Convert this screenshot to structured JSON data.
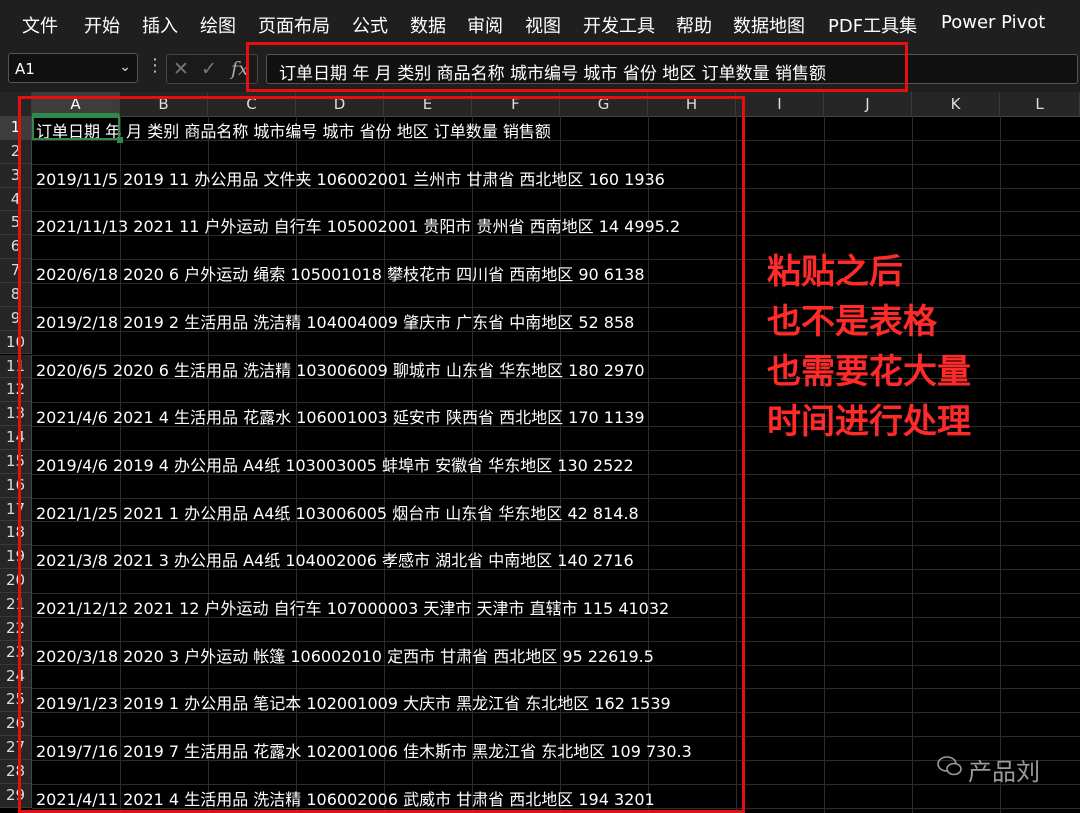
{
  "menu": [
    "文件",
    "开始",
    "插入",
    "绘图",
    "页面布局",
    "公式",
    "数据",
    "审阅",
    "视图",
    "开发工具",
    "帮助",
    "数据地图",
    "PDF工具集",
    "Power Pivot"
  ],
  "name_box": "A1",
  "formula_bar": {
    "fx": "fx",
    "cancel": "✕",
    "enter": "✓",
    "content": "订单日期 年 月 类别 商品名称 城市编号 城市 省份 地区 订单数量 销售额"
  },
  "columns": [
    "A",
    "B",
    "C",
    "D",
    "E",
    "F",
    "G",
    "H",
    "I",
    "J",
    "K",
    "L"
  ],
  "rows": [
    {
      "num": "1",
      "text": "订单日期 年 月 类别 商品名称 城市编号 城市 省份 地区 订单数量 销售额"
    },
    {
      "num": "2",
      "text": ""
    },
    {
      "num": "3",
      "text": "2019/11/5 2019 11 办公用品 文件夹 106002001 兰州市 甘肃省 西北地区 160 1936"
    },
    {
      "num": "4",
      "text": ""
    },
    {
      "num": "5",
      "text": "2021/11/13 2021 11 户外运动 自行车 105002001 贵阳市 贵州省 西南地区 14 4995.2"
    },
    {
      "num": "6",
      "text": ""
    },
    {
      "num": "7",
      "text": "2020/6/18 2020 6 户外运动 绳索 105001018 攀枝花市 四川省 西南地区 90 6138"
    },
    {
      "num": "8",
      "text": ""
    },
    {
      "num": "9",
      "text": "2019/2/18 2019 2 生活用品 洗洁精 104004009 肇庆市 广东省 中南地区 52 858"
    },
    {
      "num": "10",
      "text": ""
    },
    {
      "num": "11",
      "text": "2020/6/5 2020 6 生活用品 洗洁精 103006009 聊城市 山东省 华东地区 180 2970"
    },
    {
      "num": "12",
      "text": ""
    },
    {
      "num": "13",
      "text": "2021/4/6 2021 4 生活用品 花露水 106001003 延安市 陕西省 西北地区 170 1139"
    },
    {
      "num": "14",
      "text": ""
    },
    {
      "num": "15",
      "text": "2019/4/6 2019 4 办公用品 A4纸 103003005 蚌埠市 安徽省 华东地区 130 2522"
    },
    {
      "num": "16",
      "text": ""
    },
    {
      "num": "17",
      "text": "2021/1/25 2021 1 办公用品 A4纸 103006005 烟台市 山东省 华东地区 42 814.8"
    },
    {
      "num": "18",
      "text": ""
    },
    {
      "num": "19",
      "text": "2021/3/8 2021 3 办公用品 A4纸 104002006 孝感市 湖北省 中南地区 140 2716"
    },
    {
      "num": "20",
      "text": ""
    },
    {
      "num": "21",
      "text": "2021/12/12 2021 12 户外运动 自行车 107000003 天津市 天津市 直辖市 115 41032"
    },
    {
      "num": "22",
      "text": ""
    },
    {
      "num": "23",
      "text": "2020/3/18 2020 3 户外运动 帐篷 106002010 定西市 甘肃省 西北地区 95 22619.5"
    },
    {
      "num": "24",
      "text": ""
    },
    {
      "num": "25",
      "text": "2019/1/23 2019 1 办公用品 笔记本 102001009 大庆市 黑龙江省 东北地区 162 1539"
    },
    {
      "num": "26",
      "text": ""
    },
    {
      "num": "27",
      "text": "2019/7/16 2019 7 生活用品 花露水 102001006 佳木斯市 黑龙江省 东北地区 109 730.3"
    },
    {
      "num": "28",
      "text": ""
    },
    {
      "num": "29",
      "text": "2021/4/11 2021 4 生活用品 洗洁精 106002006 武威市 甘肃省 西北地区 194 3201"
    }
  ],
  "annotation": [
    "粘贴之后",
    "也不是表格",
    "也需要花大量",
    "时间进行处理"
  ],
  "watermark": "产品刘",
  "watermark_icon": "wechat-icon",
  "accent_color": "#2f8a4c",
  "highlight_color": "#e41010"
}
